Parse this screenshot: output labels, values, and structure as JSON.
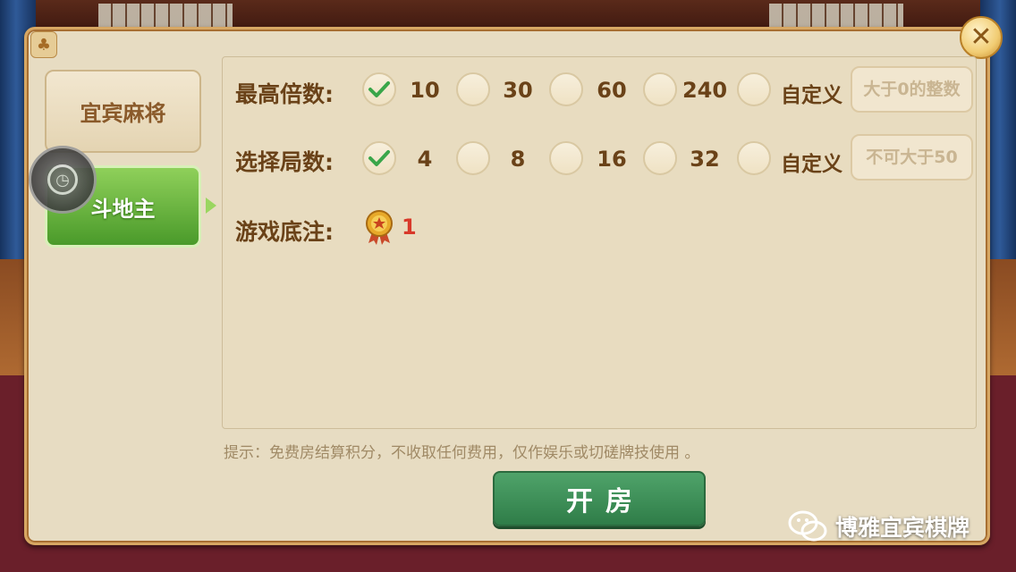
{
  "dialog": {
    "tabs": [
      {
        "label": "宜宾麻将",
        "selected": false
      },
      {
        "label": "斗地主",
        "selected": true
      }
    ],
    "close_icon": "close-icon"
  },
  "max_multiplier": {
    "label": "最高倍数:",
    "options": [
      {
        "value": "10",
        "checked": true
      },
      {
        "value": "30",
        "checked": false
      },
      {
        "value": "60",
        "checked": false
      },
      {
        "value": "240",
        "checked": false
      }
    ],
    "custom_label": "自定义",
    "custom_placeholder": "大于0的整数"
  },
  "rounds": {
    "label": "选择局数:",
    "options": [
      {
        "value": "4",
        "checked": true
      },
      {
        "value": "8",
        "checked": false
      },
      {
        "value": "16",
        "checked": false
      },
      {
        "value": "32",
        "checked": false
      }
    ],
    "custom_label": "自定义",
    "custom_placeholder": "不可大于50"
  },
  "base_bet": {
    "label": "游戏底注:",
    "value": "1"
  },
  "tip": "提示：免费房结算积分，不收取任何费用，仅作娱乐或切磋牌技使用 。",
  "open_button": "开房",
  "watermark": "博雅宜宾棋牌",
  "colors": {
    "accent_green": "#3b8c55",
    "tab_green": "#5aa832",
    "text_brown": "#6a4218",
    "bet_red": "#d8392a"
  }
}
